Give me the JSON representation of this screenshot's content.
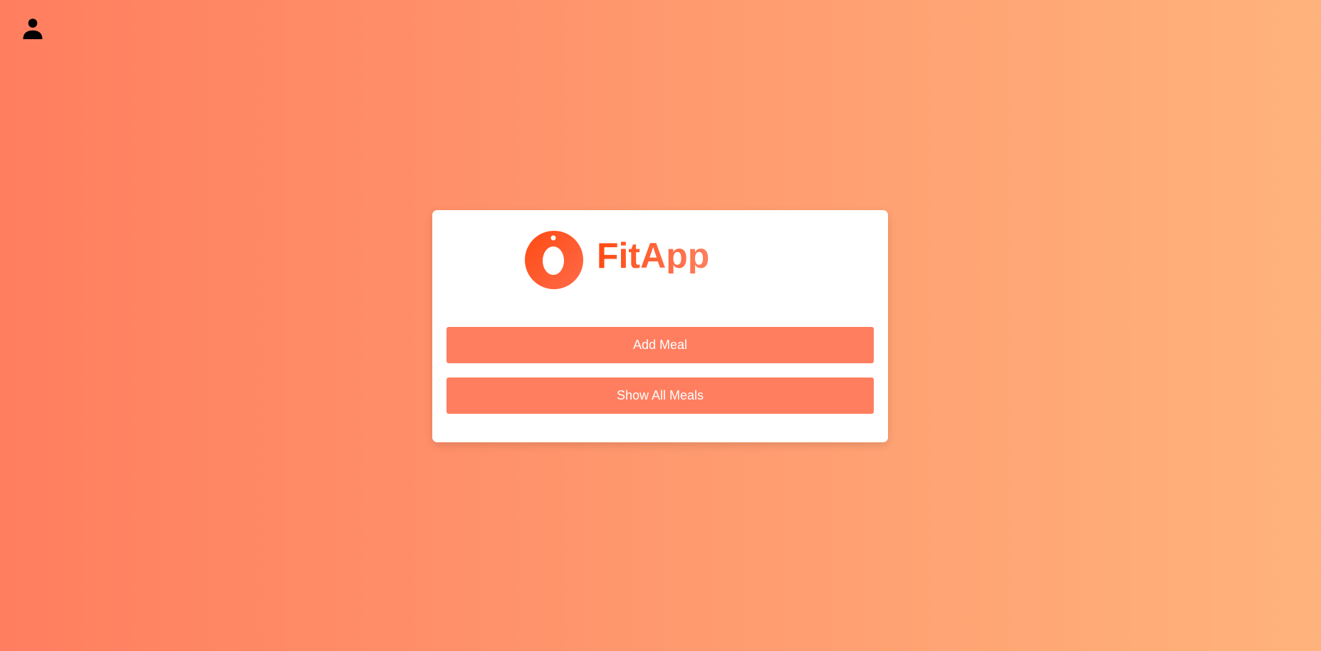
{
  "header": {
    "profile_icon": "person-icon",
    "icon_color": "#000000"
  },
  "brand": {
    "name": "FitApp",
    "logo_icon": "fitapp-logo-icon",
    "gradient": [
      "#ff4a12",
      "#ff7e5f"
    ]
  },
  "actions": {
    "add_meal_label": "Add Meal",
    "show_all_meals_label": "Show All Meals",
    "button_color": "#ff7e5f"
  },
  "theme": {
    "background_gradient": [
      "#ff7e5f",
      "#ffb37c"
    ],
    "card_color": "#ffffff"
  }
}
